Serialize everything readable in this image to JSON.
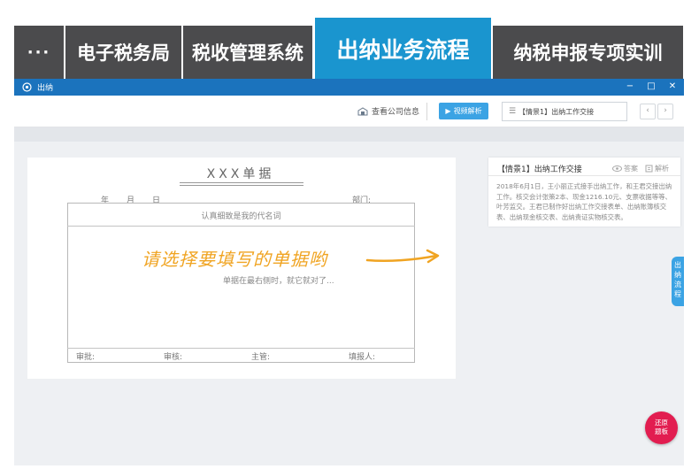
{
  "tabs": {
    "more": "···",
    "items": [
      {
        "label": "电子税务局"
      },
      {
        "label": "税收管理系统"
      },
      {
        "label": "出纳业务流程"
      },
      {
        "label": "纳税申报专项实训"
      }
    ]
  },
  "window": {
    "title": "出纳",
    "minimize": "−",
    "maximize": "□",
    "close": "✕"
  },
  "toolbar": {
    "company_info": "查看公司信息",
    "video_button": "视频解析",
    "scene_select": "【情景1】出纳工作交接",
    "prev": "‹",
    "next": "›"
  },
  "receipt": {
    "title": "XXX单据",
    "year": "年",
    "month": "月",
    "day": "日",
    "department": "部门:",
    "box_hint": "认真细致是我的代名词",
    "big_hint": "请选择要填写的单据哟",
    "sub_hint": "单据在最右侧时，就它就对了...",
    "sign_labels": [
      "审批:",
      "审核:",
      "主管:",
      "填报人:"
    ]
  },
  "scenario": {
    "title": "【情景1】出纳工作交接",
    "answer_label": "答案",
    "analysis_label": "解析",
    "body": "2018年6月1日，王小丽正式接手出纳工作，和王君交接出纳工作。核交会计张策2本、现金1216.10元、支票收据等等、叶芳监交。王君已制作好出纳工作交接表单、出纳账簿核交表、出纳现金核交表、出纳责证实物核交表。"
  },
  "side_tab": "出纳流程",
  "round_button": {
    "line1": "还原",
    "line2": "题板"
  },
  "colors": {
    "active_tab": "#1a95cf",
    "inactive_tab": "#4b4b4d",
    "titlebar": "#1b73bd",
    "accent_button": "#3ba3e4",
    "hint_orange": "#f0a422",
    "round_button": "#e21d50"
  }
}
